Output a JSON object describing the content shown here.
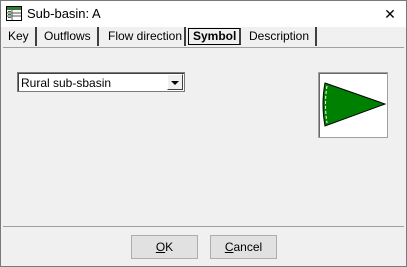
{
  "window": {
    "title": "Sub-basin: A",
    "close_glyph": "✕",
    "app_icon": "table-icon"
  },
  "tabs": [
    {
      "label": "Key",
      "active": false
    },
    {
      "label": "Outflows",
      "active": false
    },
    {
      "label": "Flow direction",
      "active": false
    },
    {
      "label": "Symbol",
      "active": true
    },
    {
      "label": "Description",
      "active": false
    }
  ],
  "symbol_tab": {
    "symbol_select": {
      "value": "Rural sub-sbasin"
    },
    "preview": {
      "shape": "triangle-icon",
      "fill_color": "#008000",
      "outline_color": "#000000"
    }
  },
  "buttons": {
    "ok": {
      "mnemonic": "O",
      "rest": "K"
    },
    "cancel": {
      "mnemonic": "C",
      "rest": "ancel"
    }
  }
}
